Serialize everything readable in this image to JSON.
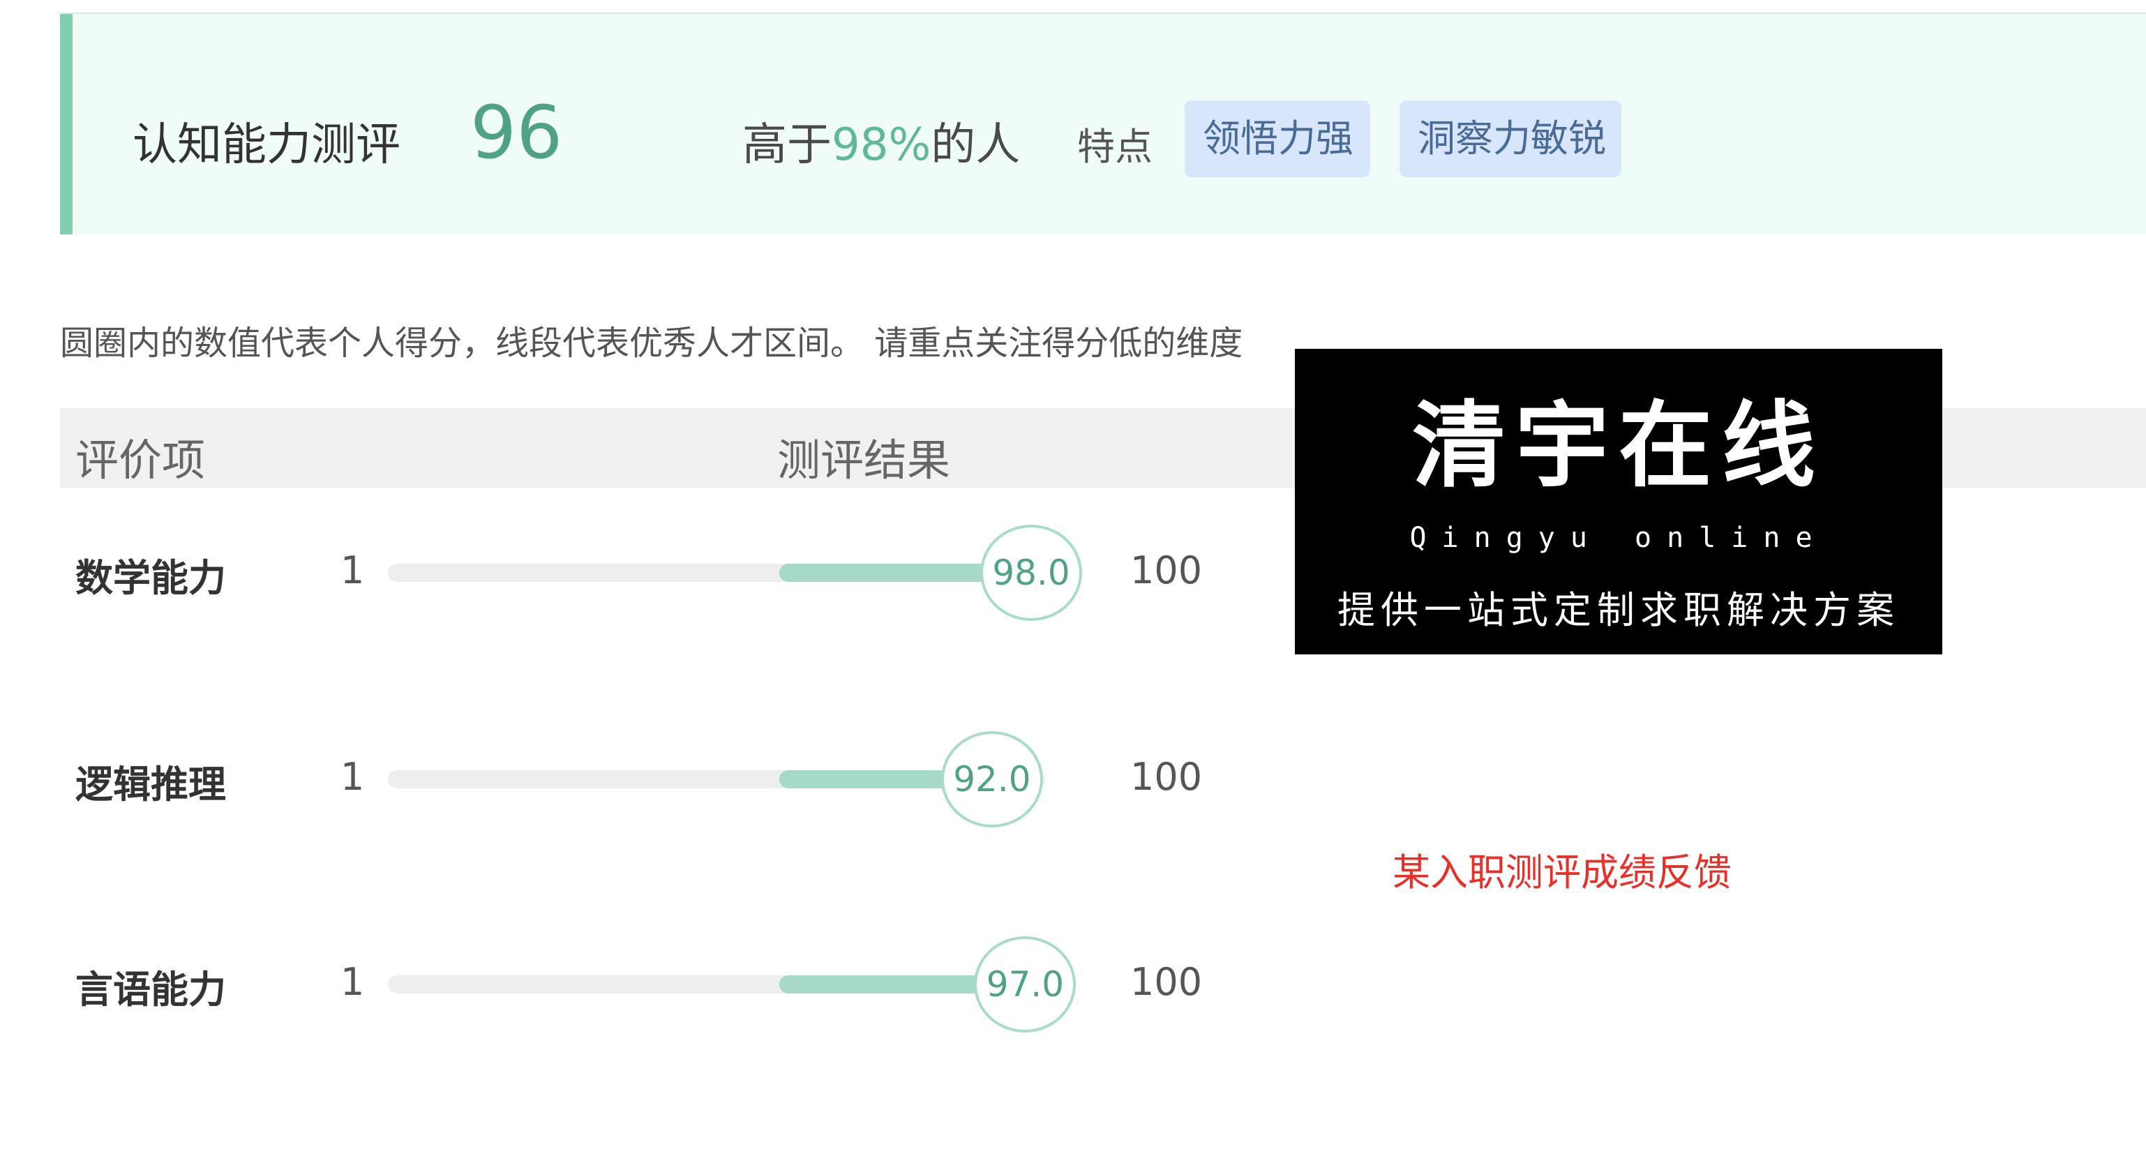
{
  "summary": {
    "title": "认知能力测评",
    "score": "96",
    "rank_prefix": "高于",
    "rank_percent": "98%",
    "rank_suffix": "的人",
    "traits_label": "特点",
    "traits": [
      "领悟力强",
      "洞察力敏锐"
    ]
  },
  "note": "圆圈内的数值代表个人得分，线段代表优秀人才区间。 请重点关注得分低的维度",
  "table": {
    "headers": {
      "item": "评价项",
      "result": "测评结果"
    },
    "scale_min": 1,
    "scale_max": 100,
    "range_min_label": "1",
    "range_max_label": "100",
    "rows": [
      {
        "label": "数学能力",
        "score": 98.0,
        "score_label": "98.0",
        "excellent_range": [
          60,
          98
        ]
      },
      {
        "label": "逻辑推理",
        "score": 92.0,
        "score_label": "92.0",
        "excellent_range": [
          60,
          92
        ]
      },
      {
        "label": "言语能力",
        "score": 97.0,
        "score_label": "97.0",
        "excellent_range": [
          60,
          97
        ]
      }
    ]
  },
  "watermark": {
    "title": "清宇在线",
    "subtitle": "Qingyu online",
    "tagline": "提供一站式定制求职解决方案"
  },
  "caption": "某入职测评成绩反馈",
  "colors": {
    "accent": "#80cfae",
    "score_text": "#4fa283",
    "band": "#a6d9c6",
    "tag_bg": "#d7e6fa",
    "caption": "#e8302a"
  }
}
